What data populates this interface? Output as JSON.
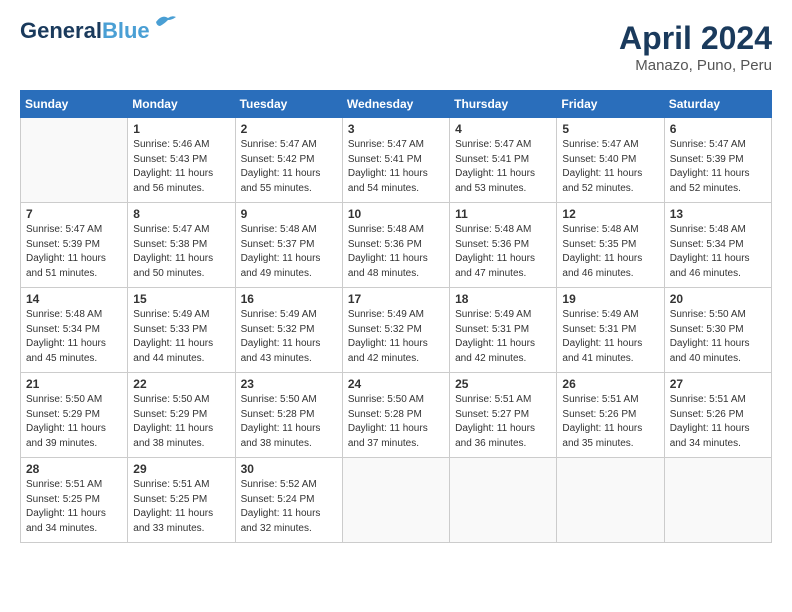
{
  "header": {
    "logo_line1": "General",
    "logo_line2": "Blue",
    "month": "April 2024",
    "location": "Manazo, Puno, Peru"
  },
  "days_of_week": [
    "Sunday",
    "Monday",
    "Tuesday",
    "Wednesday",
    "Thursday",
    "Friday",
    "Saturday"
  ],
  "weeks": [
    [
      {
        "day": "",
        "info": ""
      },
      {
        "day": "1",
        "info": "Sunrise: 5:46 AM\nSunset: 5:43 PM\nDaylight: 11 hours\nand 56 minutes."
      },
      {
        "day": "2",
        "info": "Sunrise: 5:47 AM\nSunset: 5:42 PM\nDaylight: 11 hours\nand 55 minutes."
      },
      {
        "day": "3",
        "info": "Sunrise: 5:47 AM\nSunset: 5:41 PM\nDaylight: 11 hours\nand 54 minutes."
      },
      {
        "day": "4",
        "info": "Sunrise: 5:47 AM\nSunset: 5:41 PM\nDaylight: 11 hours\nand 53 minutes."
      },
      {
        "day": "5",
        "info": "Sunrise: 5:47 AM\nSunset: 5:40 PM\nDaylight: 11 hours\nand 52 minutes."
      },
      {
        "day": "6",
        "info": "Sunrise: 5:47 AM\nSunset: 5:39 PM\nDaylight: 11 hours\nand 52 minutes."
      }
    ],
    [
      {
        "day": "7",
        "info": "Sunrise: 5:47 AM\nSunset: 5:39 PM\nDaylight: 11 hours\nand 51 minutes."
      },
      {
        "day": "8",
        "info": "Sunrise: 5:47 AM\nSunset: 5:38 PM\nDaylight: 11 hours\nand 50 minutes."
      },
      {
        "day": "9",
        "info": "Sunrise: 5:48 AM\nSunset: 5:37 PM\nDaylight: 11 hours\nand 49 minutes."
      },
      {
        "day": "10",
        "info": "Sunrise: 5:48 AM\nSunset: 5:36 PM\nDaylight: 11 hours\nand 48 minutes."
      },
      {
        "day": "11",
        "info": "Sunrise: 5:48 AM\nSunset: 5:36 PM\nDaylight: 11 hours\nand 47 minutes."
      },
      {
        "day": "12",
        "info": "Sunrise: 5:48 AM\nSunset: 5:35 PM\nDaylight: 11 hours\nand 46 minutes."
      },
      {
        "day": "13",
        "info": "Sunrise: 5:48 AM\nSunset: 5:34 PM\nDaylight: 11 hours\nand 46 minutes."
      }
    ],
    [
      {
        "day": "14",
        "info": "Sunrise: 5:48 AM\nSunset: 5:34 PM\nDaylight: 11 hours\nand 45 minutes."
      },
      {
        "day": "15",
        "info": "Sunrise: 5:49 AM\nSunset: 5:33 PM\nDaylight: 11 hours\nand 44 minutes."
      },
      {
        "day": "16",
        "info": "Sunrise: 5:49 AM\nSunset: 5:32 PM\nDaylight: 11 hours\nand 43 minutes."
      },
      {
        "day": "17",
        "info": "Sunrise: 5:49 AM\nSunset: 5:32 PM\nDaylight: 11 hours\nand 42 minutes."
      },
      {
        "day": "18",
        "info": "Sunrise: 5:49 AM\nSunset: 5:31 PM\nDaylight: 11 hours\nand 42 minutes."
      },
      {
        "day": "19",
        "info": "Sunrise: 5:49 AM\nSunset: 5:31 PM\nDaylight: 11 hours\nand 41 minutes."
      },
      {
        "day": "20",
        "info": "Sunrise: 5:50 AM\nSunset: 5:30 PM\nDaylight: 11 hours\nand 40 minutes."
      }
    ],
    [
      {
        "day": "21",
        "info": "Sunrise: 5:50 AM\nSunset: 5:29 PM\nDaylight: 11 hours\nand 39 minutes."
      },
      {
        "day": "22",
        "info": "Sunrise: 5:50 AM\nSunset: 5:29 PM\nDaylight: 11 hours\nand 38 minutes."
      },
      {
        "day": "23",
        "info": "Sunrise: 5:50 AM\nSunset: 5:28 PM\nDaylight: 11 hours\nand 38 minutes."
      },
      {
        "day": "24",
        "info": "Sunrise: 5:50 AM\nSunset: 5:28 PM\nDaylight: 11 hours\nand 37 minutes."
      },
      {
        "day": "25",
        "info": "Sunrise: 5:51 AM\nSunset: 5:27 PM\nDaylight: 11 hours\nand 36 minutes."
      },
      {
        "day": "26",
        "info": "Sunrise: 5:51 AM\nSunset: 5:26 PM\nDaylight: 11 hours\nand 35 minutes."
      },
      {
        "day": "27",
        "info": "Sunrise: 5:51 AM\nSunset: 5:26 PM\nDaylight: 11 hours\nand 34 minutes."
      }
    ],
    [
      {
        "day": "28",
        "info": "Sunrise: 5:51 AM\nSunset: 5:25 PM\nDaylight: 11 hours\nand 34 minutes."
      },
      {
        "day": "29",
        "info": "Sunrise: 5:51 AM\nSunset: 5:25 PM\nDaylight: 11 hours\nand 33 minutes."
      },
      {
        "day": "30",
        "info": "Sunrise: 5:52 AM\nSunset: 5:24 PM\nDaylight: 11 hours\nand 32 minutes."
      },
      {
        "day": "",
        "info": ""
      },
      {
        "day": "",
        "info": ""
      },
      {
        "day": "",
        "info": ""
      },
      {
        "day": "",
        "info": ""
      }
    ]
  ]
}
